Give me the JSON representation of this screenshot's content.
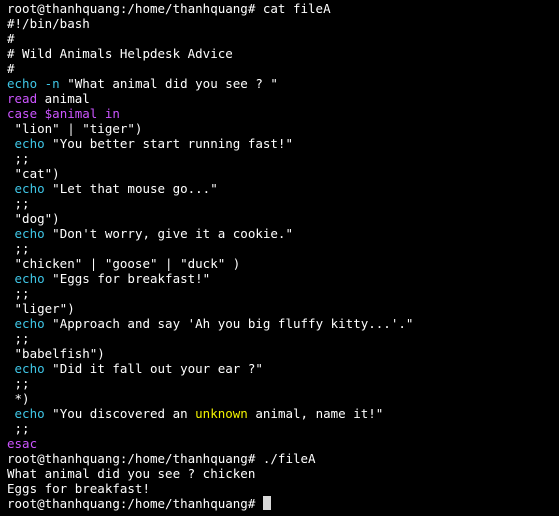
{
  "colors": {
    "background": "#000000",
    "text": "#ffffff",
    "keyword": "#cc55ff",
    "command": "#3fc6e6",
    "highlight": "#f2f200",
    "cursor": "#d9d9d9"
  },
  "lines": [
    [
      {
        "t": "root@thanhquang:/home/thanhquang# cat fileA",
        "c": "txt"
      }
    ],
    [
      {
        "t": "#!/bin/bash",
        "c": "txt"
      }
    ],
    [
      {
        "t": "#",
        "c": "txt"
      }
    ],
    [
      {
        "t": "# Wild Animals Helpdesk Advice",
        "c": "txt"
      }
    ],
    [
      {
        "t": "#",
        "c": "txt"
      }
    ],
    [
      {
        "t": "echo -n",
        "c": "cmd"
      },
      {
        "t": " \"What animal did you see ? \"",
        "c": "txt"
      }
    ],
    [
      {
        "t": "read",
        "c": "kw"
      },
      {
        "t": " animal",
        "c": "txt"
      }
    ],
    [
      {
        "t": "case",
        "c": "kw"
      },
      {
        "t": " ",
        "c": "txt"
      },
      {
        "t": "$animal",
        "c": "var"
      },
      {
        "t": " in",
        "c": "kw"
      }
    ],
    [
      {
        "t": " \"lion\" | \"tiger\")",
        "c": "txt"
      }
    ],
    [
      {
        "t": " echo",
        "c": "cmd"
      },
      {
        "t": " \"You better start running fast!\"",
        "c": "txt"
      }
    ],
    [
      {
        "t": " ;;",
        "c": "semi"
      }
    ],
    [
      {
        "t": " \"cat\")",
        "c": "txt"
      }
    ],
    [
      {
        "t": " echo",
        "c": "cmd"
      },
      {
        "t": " \"Let that mouse go...\"",
        "c": "txt"
      }
    ],
    [
      {
        "t": " ;;",
        "c": "semi"
      }
    ],
    [
      {
        "t": " \"dog\")",
        "c": "txt"
      }
    ],
    [
      {
        "t": " echo",
        "c": "cmd"
      },
      {
        "t": " \"Don't worry, give it a cookie.\"",
        "c": "txt"
      }
    ],
    [
      {
        "t": " ;;",
        "c": "semi"
      }
    ],
    [
      {
        "t": " \"chicken\" | \"goose\" | \"duck\" )",
        "c": "txt"
      }
    ],
    [
      {
        "t": " echo",
        "c": "cmd"
      },
      {
        "t": " \"Eggs for breakfast!\"",
        "c": "txt"
      }
    ],
    [
      {
        "t": " ;;",
        "c": "semi"
      }
    ],
    [
      {
        "t": " \"liger\")",
        "c": "txt"
      }
    ],
    [
      {
        "t": " echo",
        "c": "cmd"
      },
      {
        "t": " \"Approach and say 'Ah you big fluffy kitty...'.\"",
        "c": "txt"
      }
    ],
    [
      {
        "t": " ;;",
        "c": "semi"
      }
    ],
    [
      {
        "t": " \"babelfish\")",
        "c": "txt"
      }
    ],
    [
      {
        "t": " echo",
        "c": "cmd"
      },
      {
        "t": " \"Did it fall out your ear ?\"",
        "c": "txt"
      }
    ],
    [
      {
        "t": " ;;",
        "c": "semi"
      }
    ],
    [
      {
        "t": " *)",
        "c": "txt"
      }
    ],
    [
      {
        "t": " echo",
        "c": "cmd"
      },
      {
        "t": " \"You discovered an ",
        "c": "txt"
      },
      {
        "t": "unknown",
        "c": "hl"
      },
      {
        "t": " animal, name it!\"",
        "c": "txt"
      }
    ],
    [
      {
        "t": " ;;",
        "c": "semi"
      }
    ],
    [
      {
        "t": "esac",
        "c": "kw"
      }
    ],
    [
      {
        "t": "root@thanhquang:/home/thanhquang# ./fileA",
        "c": "txt"
      }
    ],
    [
      {
        "t": "What animal did you see ? chicken",
        "c": "txt"
      }
    ],
    [
      {
        "t": "Eggs for breakfast!",
        "c": "txt"
      }
    ],
    [
      {
        "t": "root@thanhquang:/home/thanhquang# ",
        "c": "txt"
      }
    ]
  ]
}
